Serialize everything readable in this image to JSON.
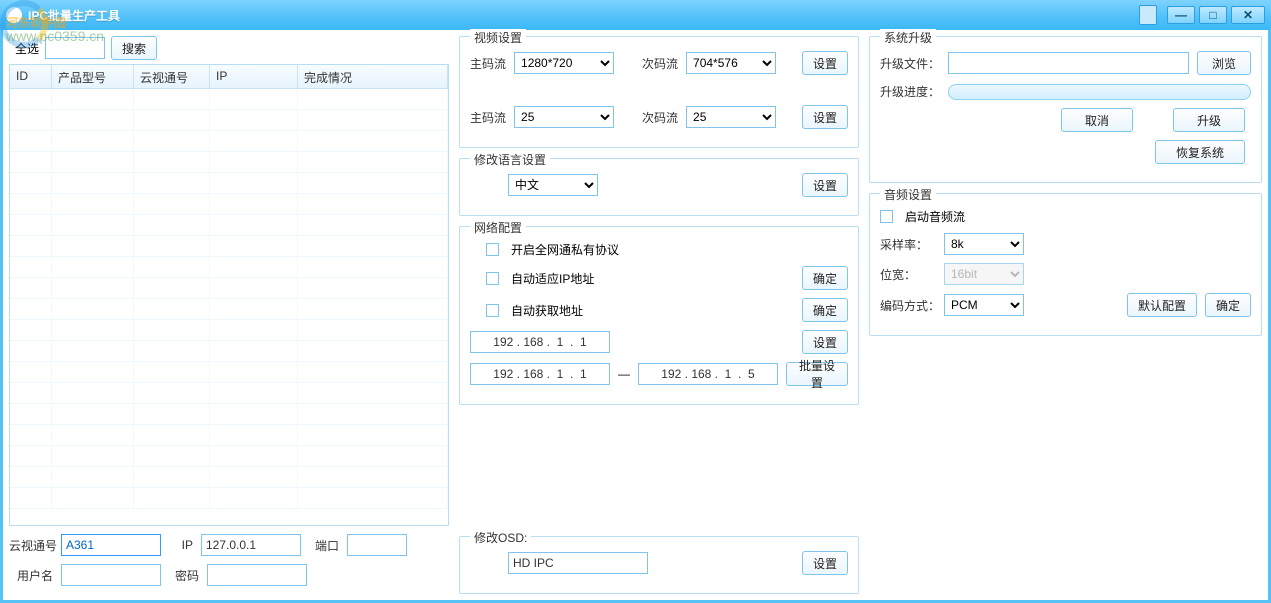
{
  "window": {
    "title": "IPC批量生产工具",
    "buttons": {
      "min": "—",
      "max": "□",
      "close": "✕"
    }
  },
  "watermark": {
    "text": "河东软件园",
    "url": "www.pc0359.cn"
  },
  "left": {
    "select_all": "全选",
    "search": "搜索",
    "columns": {
      "id": "ID",
      "model": "产品型号",
      "cloud": "云视通号",
      "ip": "IP",
      "status": "完成情况"
    },
    "form": {
      "cloud_label": "云视通号",
      "cloud_value": "A361",
      "ip_label": "IP",
      "ip_value": "127.0.0.1",
      "port_label": "端口",
      "port_value": "",
      "user_label": "用户名",
      "user_value": "",
      "pwd_label": "密码",
      "pwd_value": ""
    }
  },
  "video": {
    "legend": "视频设置",
    "main_stream_label": "主码流",
    "sub_stream_label": "次码流",
    "res_main": "1280*720",
    "res_sub": "704*576",
    "fps_main": "25",
    "fps_sub": "25",
    "set_btn": "设置"
  },
  "lang": {
    "legend": "修改语言设置",
    "value": "中文",
    "set_btn": "设置"
  },
  "net": {
    "legend": "网络配置",
    "chk_priv": "开启全网通私有协议",
    "chk_auto_adapt": "自动适应IP地址",
    "chk_auto_get": "自动获取地址",
    "ip_single": "192 . 168 .  1  .  1",
    "ip_from": "192 . 168 .  1  .  1",
    "ip_to": "192 . 168 .  1  .  5",
    "dash": "—",
    "ok_btn": "确定",
    "set_btn": "设置",
    "batch_btn": "批量设置"
  },
  "osd": {
    "legend": "修改OSD:",
    "value": "HD IPC",
    "set_btn": "设置"
  },
  "upgrade": {
    "legend": "系统升级",
    "file_label": "升级文件：",
    "file_value": "",
    "progress_label": "升级进度：",
    "browse": "浏览",
    "cancel": "取消",
    "upgrade": "升级",
    "restore": "恢复系统"
  },
  "audio": {
    "legend": "音频设置",
    "enable": "启动音频流",
    "rate_label": "采样率：",
    "rate": "8k",
    "bits_label": "位宽：",
    "bits": "16bit",
    "codec_label": "编码方式：",
    "codec": "PCM",
    "default_btn": "默认配置",
    "ok_btn": "确定"
  }
}
